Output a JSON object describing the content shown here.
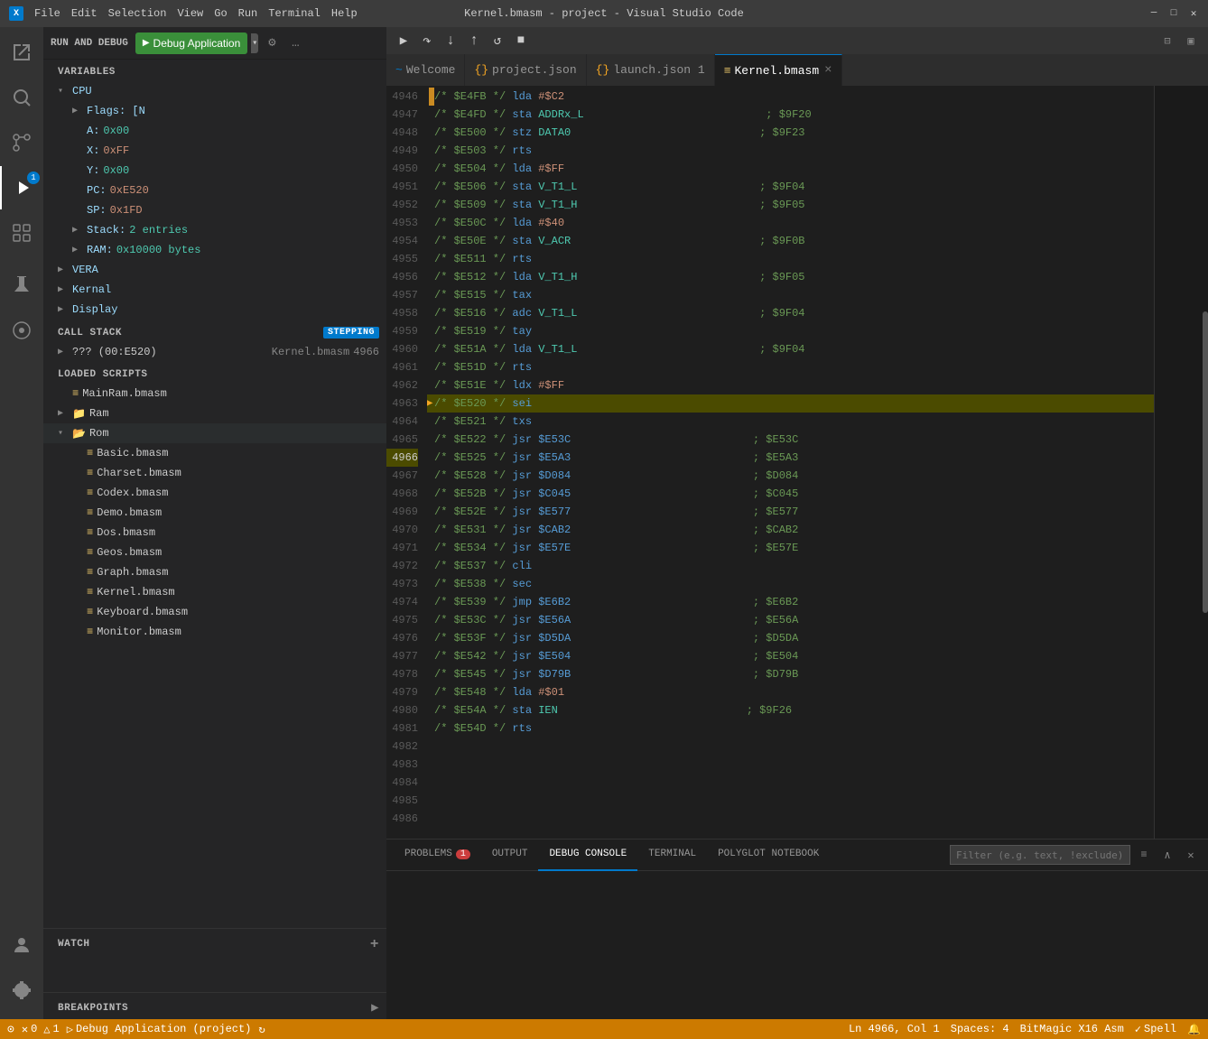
{
  "titleBar": {
    "appName": "Kernel.bmasm - project - Visual Studio Code",
    "menus": [
      "File",
      "Edit",
      "Selection",
      "View",
      "Go",
      "Run",
      "Terminal",
      "Help"
    ],
    "controls": [
      "─",
      "□",
      "✕"
    ]
  },
  "activityBar": {
    "icons": [
      {
        "name": "explorer-icon",
        "symbol": "⎘",
        "active": false,
        "badge": false
      },
      {
        "name": "search-icon",
        "symbol": "🔍",
        "active": false,
        "badge": false
      },
      {
        "name": "source-control-icon",
        "symbol": "⎇",
        "active": false,
        "badge": false
      },
      {
        "name": "run-debug-icon",
        "symbol": "▷",
        "active": true,
        "badge": true
      },
      {
        "name": "extensions-icon",
        "symbol": "⊞",
        "active": false,
        "badge": false
      }
    ],
    "bottomIcons": [
      {
        "name": "test-icon",
        "symbol": "⚗"
      },
      {
        "name": "remote-icon",
        "symbol": "⊙"
      },
      {
        "name": "bookmarks-icon",
        "symbol": "☆"
      },
      {
        "name": "account-icon",
        "symbol": "👤"
      },
      {
        "name": "settings-icon",
        "symbol": "⚙"
      }
    ]
  },
  "sidebar": {
    "runDebugHeader": "RUN AND DEBUG",
    "debugConfig": "Debug Application",
    "configButtons": [
      "⚙",
      "…"
    ],
    "variables": {
      "header": "VARIABLES",
      "cpu": {
        "label": "CPU",
        "flags": {
          "label": "Flags: [N",
          "value": "]"
        },
        "a": {
          "label": "A:",
          "value": "0x00"
        },
        "x": {
          "label": "X:",
          "value": "0xFF"
        },
        "y": {
          "label": "Y:",
          "value": "0x00"
        },
        "pc": {
          "label": "PC:",
          "value": "0xE520"
        },
        "sp": {
          "label": "SP:",
          "value": "0x1FD"
        },
        "stack": {
          "label": "Stack:",
          "value": "2 entries"
        },
        "ram": {
          "label": "RAM:",
          "value": "0x10000 bytes"
        }
      },
      "vera": {
        "label": "VERA"
      },
      "kernal": {
        "label": "Kernal"
      },
      "display": {
        "label": "Display"
      }
    },
    "callStack": {
      "header": "CALL STACK",
      "stepBadge": "Stepping",
      "items": [
        {
          "name": "??? (00:E520)",
          "source": "Kernel.bmasm",
          "line": "4966"
        }
      ]
    },
    "loadedScripts": {
      "header": "LOADED SCRIPTS",
      "items": [
        {
          "name": "MainRam.bmasm",
          "indent": 1
        },
        {
          "name": "Ram",
          "indent": 1
        },
        {
          "name": "Rom",
          "indent": 1,
          "expanded": true
        },
        {
          "name": "Basic.bmasm",
          "indent": 2
        },
        {
          "name": "Charset.bmasm",
          "indent": 2
        },
        {
          "name": "Codex.bmasm",
          "indent": 2
        },
        {
          "name": "Demo.bmasm",
          "indent": 2
        },
        {
          "name": "Dos.bmasm",
          "indent": 2
        },
        {
          "name": "Geos.bmasm",
          "indent": 2
        },
        {
          "name": "Graph.bmasm",
          "indent": 2
        },
        {
          "name": "Kernel.bmasm",
          "indent": 2
        },
        {
          "name": "Keyboard.bmasm",
          "indent": 2
        },
        {
          "name": "Monitor.bmasm",
          "indent": 2
        }
      ]
    },
    "watch": {
      "header": "WATCH"
    },
    "breakpoints": {
      "header": "BREAKPOINTS"
    }
  },
  "tabs": [
    {
      "label": "Welcome",
      "icon": "~",
      "active": false,
      "closable": false
    },
    {
      "label": "project.json",
      "icon": "{}",
      "active": false,
      "closable": false
    },
    {
      "label": "launch.json 1",
      "icon": "{}",
      "active": false,
      "closable": false,
      "modified": true
    },
    {
      "label": "Kernel.bmasm",
      "icon": "≡",
      "active": true,
      "closable": true
    }
  ],
  "codeLines": [
    {
      "num": "4946",
      "addr": "$E4FB",
      "op": "lda",
      "arg": "#$C2",
      "comment": ""
    },
    {
      "num": "4947",
      "addr": "$E4FD",
      "op": "sta",
      "arg": "ADDRx_L",
      "comment": "; $9F20"
    },
    {
      "num": "4948",
      "addr": "$E500",
      "op": "stz",
      "arg": "DATA0",
      "comment": "; $9F23"
    },
    {
      "num": "4949",
      "addr": "$E503",
      "op": "rts",
      "arg": "",
      "comment": ""
    },
    {
      "num": "4950",
      "addr": "",
      "op": "",
      "arg": "",
      "comment": ""
    },
    {
      "num": "4951",
      "addr": "$E504",
      "op": "lda",
      "arg": "#$FF",
      "comment": ""
    },
    {
      "num": "4952",
      "addr": "$E506",
      "op": "sta",
      "arg": "V_T1_L",
      "comment": "; $9F04"
    },
    {
      "num": "4953",
      "addr": "$E509",
      "op": "sta",
      "arg": "V_T1_H",
      "comment": "; $9F05"
    },
    {
      "num": "4954",
      "addr": "$E50C",
      "op": "lda",
      "arg": "#$40",
      "comment": ""
    },
    {
      "num": "4955",
      "addr": "$E50E",
      "op": "sta",
      "arg": "V_ACR",
      "comment": "; $9F0B"
    },
    {
      "num": "4956",
      "addr": "$E511",
      "op": "rts",
      "arg": "",
      "comment": ""
    },
    {
      "num": "4957",
      "addr": "",
      "op": "",
      "arg": "",
      "comment": ""
    },
    {
      "num": "4958",
      "addr": "$E512",
      "op": "lda",
      "arg": "V_T1_H",
      "comment": "; $9F05"
    },
    {
      "num": "4959",
      "addr": "$E515",
      "op": "tax",
      "arg": "",
      "comment": ""
    },
    {
      "num": "4960",
      "addr": "$E516",
      "op": "adc",
      "arg": "V_T1_L",
      "comment": "; $9F04"
    },
    {
      "num": "4961",
      "addr": "$E519",
      "op": "tay",
      "arg": "",
      "comment": ""
    },
    {
      "num": "4962",
      "addr": "$E51A",
      "op": "lda",
      "arg": "V_T1_L",
      "comment": "; $9F04"
    },
    {
      "num": "4963",
      "addr": "$E51D",
      "op": "rts",
      "arg": "",
      "comment": ""
    },
    {
      "num": "4964",
      "addr": "",
      "op": "",
      "arg": "",
      "comment": ""
    },
    {
      "num": "4965",
      "addr": "$E51E",
      "op": "ldx",
      "arg": "#$FF",
      "comment": ""
    },
    {
      "num": "4966",
      "addr": "$E520",
      "op": "sei",
      "arg": "",
      "comment": "",
      "current": true
    },
    {
      "num": "4967",
      "addr": "$E521",
      "op": "txs",
      "arg": "",
      "comment": ""
    },
    {
      "num": "4968",
      "addr": "$E522",
      "op": "jsr",
      "arg": "$E53C",
      "comment": "; $E53C"
    },
    {
      "num": "4969",
      "addr": "$E525",
      "op": "jsr",
      "arg": "$E5A3",
      "comment": "; $E5A3"
    },
    {
      "num": "4970",
      "addr": "$E528",
      "op": "jsr",
      "arg": "$D084",
      "comment": "; $D084"
    },
    {
      "num": "4971",
      "addr": "$E52B",
      "op": "jsr",
      "arg": "$C045",
      "comment": "; $C045"
    },
    {
      "num": "4972",
      "addr": "$E52E",
      "op": "jsr",
      "arg": "$E577",
      "comment": "; $E577"
    },
    {
      "num": "4973",
      "addr": "$E531",
      "op": "jsr",
      "arg": "$CAB2",
      "comment": "; $CAB2"
    },
    {
      "num": "4974",
      "addr": "$E534",
      "op": "jsr",
      "arg": "$E57E",
      "comment": "; $E57E"
    },
    {
      "num": "4975",
      "addr": "$E537",
      "op": "cli",
      "arg": "",
      "comment": ""
    },
    {
      "num": "4976",
      "addr": "$E538",
      "op": "sec",
      "arg": "",
      "comment": ""
    },
    {
      "num": "4977",
      "addr": "$E539",
      "op": "jmp",
      "arg": "$E6B2",
      "comment": "; $E6B2"
    },
    {
      "num": "4978",
      "addr": "",
      "op": "",
      "arg": "",
      "comment": ""
    },
    {
      "num": "4979",
      "addr": "$E53C",
      "op": "jsr",
      "arg": "$E56A",
      "comment": "; $E56A"
    },
    {
      "num": "4980",
      "addr": "$E53F",
      "op": "jsr",
      "arg": "$D5DA",
      "comment": "; $D5DA"
    },
    {
      "num": "4981",
      "addr": "$E542",
      "op": "jsr",
      "arg": "$E504",
      "comment": "; $E504"
    },
    {
      "num": "4982",
      "addr": "$E545",
      "op": "jsr",
      "arg": "$D79B",
      "comment": "; $D79B"
    },
    {
      "num": "4983",
      "addr": "$E548",
      "op": "lda",
      "arg": "#$01",
      "comment": ""
    },
    {
      "num": "4984",
      "addr": "$E54A",
      "op": "sta",
      "arg": "IEN",
      "comment": "; $9F26"
    },
    {
      "num": "4985",
      "addr": "$E54D",
      "op": "rts",
      "arg": "",
      "comment": ""
    },
    {
      "num": "4986",
      "addr": "",
      "op": "",
      "arg": "",
      "comment": ""
    }
  ],
  "panel": {
    "tabs": [
      {
        "label": "PROBLEMS",
        "badge": "1",
        "active": false
      },
      {
        "label": "OUTPUT",
        "badge": null,
        "active": false
      },
      {
        "label": "DEBUG CONSOLE",
        "badge": null,
        "active": true
      },
      {
        "label": "TERMINAL",
        "badge": null,
        "active": false
      },
      {
        "label": "POLYGLOT NOTEBOOK",
        "badge": null,
        "active": false
      }
    ],
    "filterPlaceholder": "Filter (e.g. text, !exclude)"
  },
  "statusBar": {
    "left": [
      {
        "icon": "⊙",
        "text": "0"
      },
      {
        "icon": "⚠",
        "text": "0 △ 1"
      },
      {
        "icon": "▷",
        "text": "Debug Application (project)"
      },
      {
        "icon": "↻",
        "text": ""
      }
    ],
    "right": [
      {
        "text": "Ln 4966, Col 1"
      },
      {
        "text": "Spaces: 4"
      },
      {
        "text": "BitMagic X16 Asm"
      },
      {
        "text": "✓ Spell"
      },
      {
        "text": "⚡"
      },
      {
        "text": "Ⓦ"
      }
    ]
  }
}
